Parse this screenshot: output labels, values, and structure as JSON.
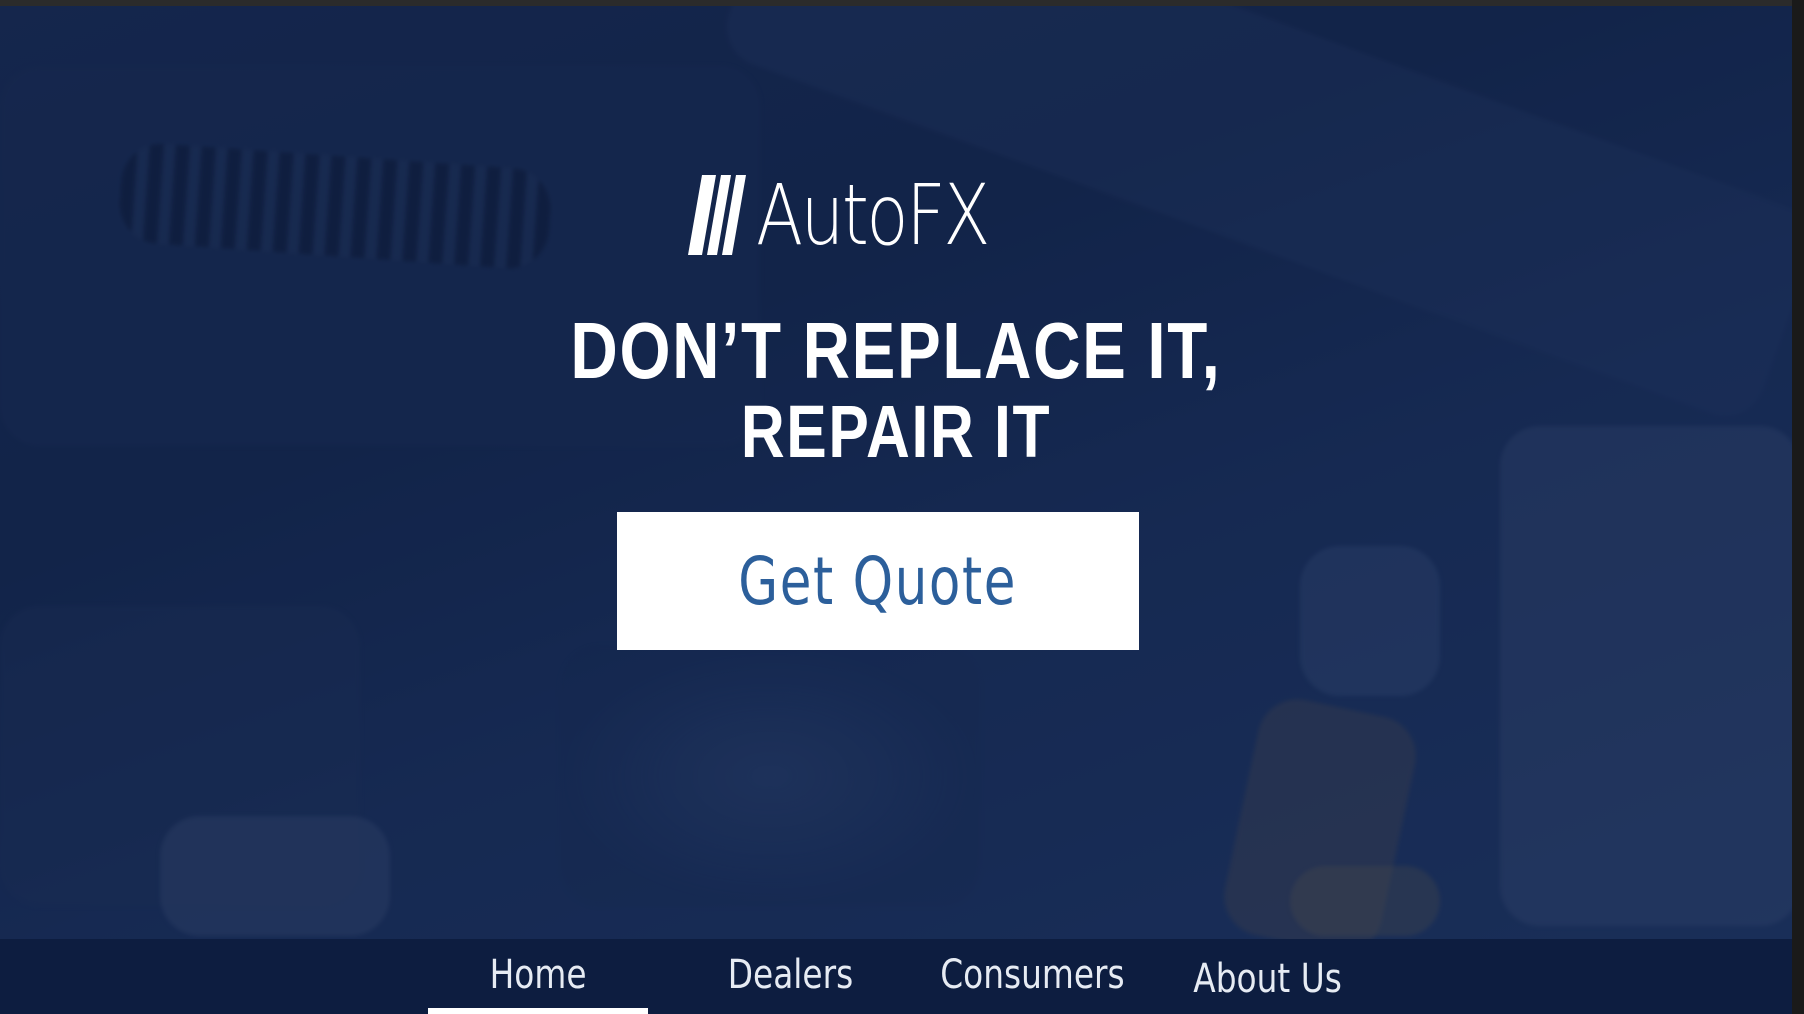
{
  "brand": {
    "logo_text": "AutoFX",
    "logo_icon": "slash-stripes-icon"
  },
  "hero": {
    "headline_line1": "DON’T REPLACE IT,",
    "headline_line2": "REPAIR IT",
    "cta_label": "Get Quote"
  },
  "nav": {
    "items": [
      {
        "label": "Home",
        "active": true
      },
      {
        "label": "Dealers",
        "active": false
      },
      {
        "label": "Consumers",
        "active": false
      },
      {
        "label": "About Us",
        "active": false
      }
    ]
  },
  "colors": {
    "overlay_navy": "#102046",
    "nav_bar": "#0d1d40",
    "cta_text": "#2c5f9b",
    "white": "#ffffff"
  }
}
